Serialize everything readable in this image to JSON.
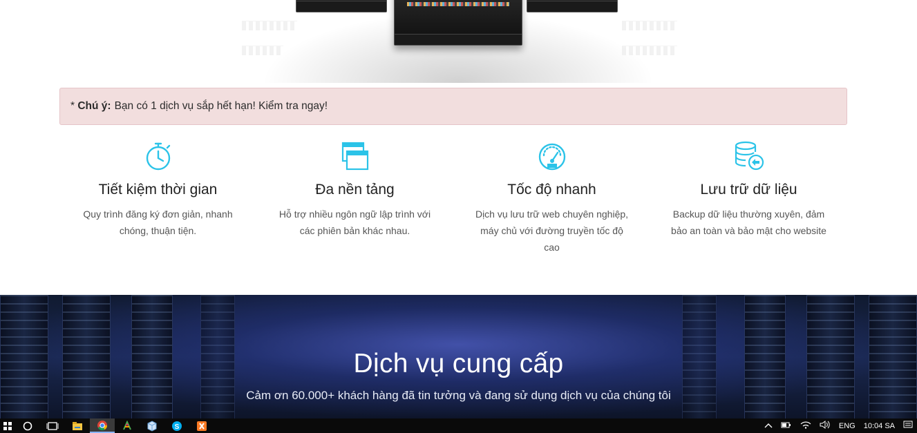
{
  "alert": {
    "prefix": "*",
    "label": "Chú ý:",
    "message": "Bạn có 1 dịch vụ sắp hết hạn! Kiểm tra ngay!"
  },
  "features": [
    {
      "icon": "stopwatch-icon",
      "title": "Tiết kiệm thời gian",
      "desc": "Quy trình đăng ký đơn giản, nhanh chóng, thuận tiện."
    },
    {
      "icon": "windows-icon",
      "title": "Đa nền tảng",
      "desc": "Hỗ trợ nhiều ngôn ngữ lập trình với các phiên bản khác nhau."
    },
    {
      "icon": "speedometer-icon",
      "title": "Tốc độ nhanh",
      "desc": "Dịch vụ lưu trữ web chuyên nghiệp, máy chủ với đường truyền tốc độ cao"
    },
    {
      "icon": "database-icon",
      "title": "Lưu trữ dữ liệu",
      "desc": "Backup dữ liệu thường xuyên, đảm bảo an toàn và bảo mật cho website"
    }
  ],
  "services": {
    "title": "Dịch vụ cung cấp",
    "subtitle": "Cảm ơn 60.000+ khách hàng đã tin tưởng và đang sử dụng dịch vụ của chúng tôi"
  },
  "taskbar": {
    "language": "ENG",
    "time": "10:04 SA",
    "apps": [
      "start-icon",
      "search-icon",
      "task-view-icon",
      "file-explorer-icon",
      "chrome-icon",
      "app-icon",
      "box-icon",
      "skype-icon",
      "xampp-icon"
    ]
  },
  "colors": {
    "accent": "#2bc3e8",
    "alert_bg": "#f2dede",
    "banner": "#1a2850",
    "taskbar": "#0a0a0a"
  }
}
